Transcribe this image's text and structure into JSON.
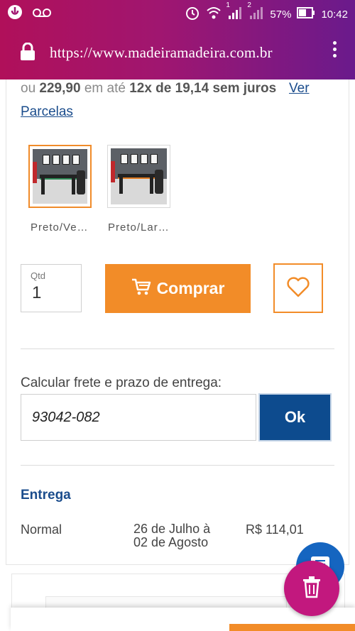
{
  "status_bar": {
    "battery": "57%",
    "time": "10:42",
    "sim1": "1",
    "sim2": "2",
    "icons": [
      "notification-icon",
      "voicemail-icon",
      "alarm-icon",
      "wifi-icon",
      "signal-icon",
      "battery-icon"
    ]
  },
  "browser": {
    "url": "https://www.madeiramadeira.com.br",
    "lock_icon": "lock-icon",
    "menu_icon": "overflow-menu-icon"
  },
  "price": {
    "prefix": "ou",
    "amount": "229,90",
    "until": "em até",
    "installments": "12x de 19,14 sem juros",
    "link_part1": "Ver",
    "link_part2": "Parcelas"
  },
  "variants": [
    {
      "label": "Preto/Ve…",
      "selected": true,
      "accent": "#2e8b57"
    },
    {
      "label": "Preto/Lar…",
      "selected": false,
      "accent": "#e07a20"
    }
  ],
  "purchase": {
    "qty_label": "Qtd",
    "qty_value": "1",
    "buy_label": "Comprar",
    "cart_icon": "cart-icon",
    "wishlist_icon": "heart-icon"
  },
  "shipping": {
    "label": "Calcular frete e prazo de entrega:",
    "cep_value": "93042-082",
    "ok_label": "Ok",
    "section_title": "Entrega",
    "option": {
      "type": "Normal",
      "date_line1": "26 de Julho à",
      "date_line2": "02 de Agosto",
      "price": "R$ 114,01"
    }
  },
  "floating": {
    "chat_icon": "chat-icon",
    "trash_icon": "trash-icon"
  },
  "colors": {
    "accent_orange": "#f28c28",
    "accent_blue": "#0d4b8e",
    "link_blue": "#1a4c8c",
    "fab_magenta": "#c2187e"
  }
}
